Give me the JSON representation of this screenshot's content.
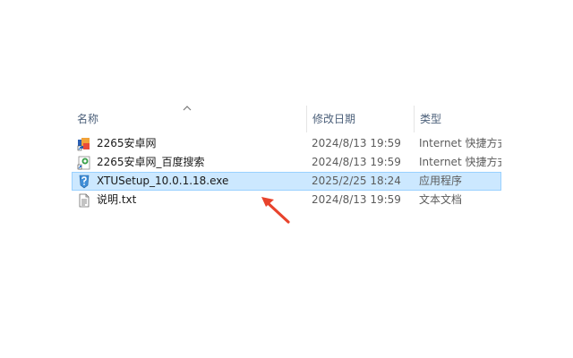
{
  "columns": {
    "name": "名称",
    "date": "修改日期",
    "type": "类型"
  },
  "files": [
    {
      "name": "2265安卓网",
      "date": "2024/8/13 19:59",
      "type": "Internet 快捷方式",
      "icon": "url-shortcut-icon",
      "selected": false
    },
    {
      "name": "2265安卓网_百度搜索",
      "date": "2024/8/13 19:59",
      "type": "Internet 快捷方式",
      "icon": "url-shortcut-icon",
      "selected": false
    },
    {
      "name": "XTUSetup_10.0.1.18.exe",
      "date": "2025/2/25 18:24",
      "type": "应用程序",
      "icon": "installer-exe-icon",
      "selected": true
    },
    {
      "name": "说明.txt",
      "date": "2024/8/13 19:59",
      "type": "文本文档",
      "icon": "text-document-icon",
      "selected": false
    }
  ],
  "colors": {
    "selection_bg": "#cce8ff",
    "selection_border": "#99d1ff",
    "annotation_arrow": "#e8432c",
    "header_text": "#4c607a"
  },
  "sort": {
    "column": "name",
    "direction": "ascending"
  }
}
